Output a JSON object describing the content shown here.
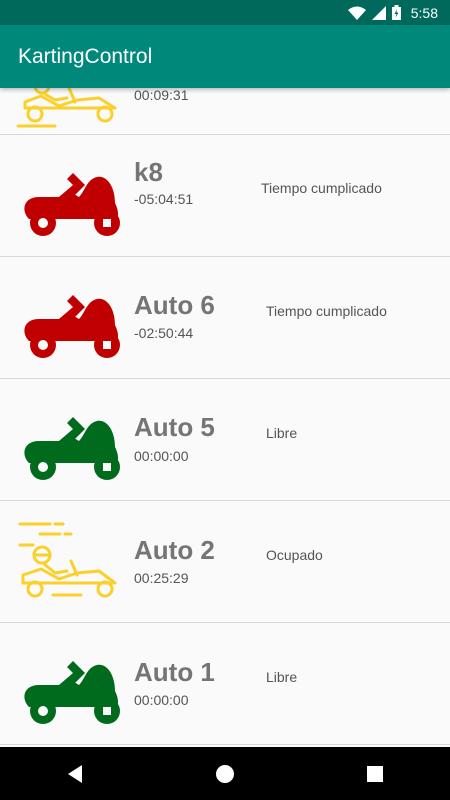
{
  "status_bar": {
    "time": "5:58"
  },
  "app_bar": {
    "title": "KartingControl"
  },
  "karts": [
    {
      "name": "",
      "timer": "00:09:31",
      "status": "",
      "state": "busy",
      "color": "#fbd02a"
    },
    {
      "name": "k8",
      "timer": "-05:04:51",
      "status": "Tiempo cumplicado",
      "state": "overtime",
      "color": "#c00000"
    },
    {
      "name": "Auto 6",
      "timer": "-02:50:44",
      "status": "Tiempo cumplicado",
      "state": "overtime",
      "color": "#c00000"
    },
    {
      "name": "Auto 5",
      "timer": "00:00:00",
      "status": "Libre",
      "state": "free",
      "color": "#006b1c"
    },
    {
      "name": "Auto 2",
      "timer": "00:25:29",
      "status": "Ocupado",
      "state": "busy",
      "color": "#fbd02a"
    },
    {
      "name": "Auto 1",
      "timer": "00:00:00",
      "status": "Libre",
      "state": "free",
      "color": "#006b1c"
    }
  ]
}
